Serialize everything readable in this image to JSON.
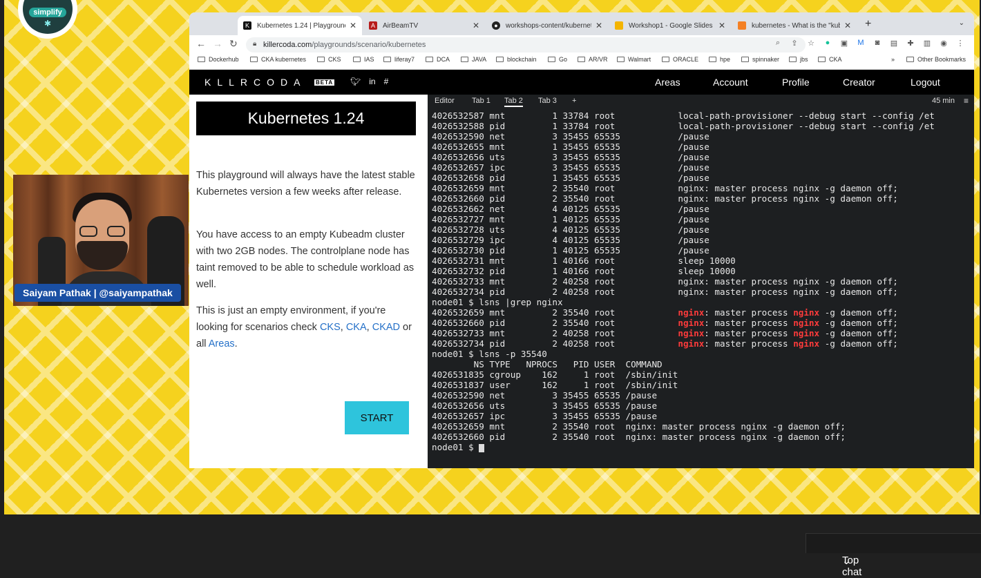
{
  "presenter": {
    "name": "Saiyam Pathak | @saiyampathak",
    "logo_text": "simplify"
  },
  "browser": {
    "tabs": [
      {
        "title": "Kubernetes 1.24 | Playgrounds",
        "favicon": "k-icon",
        "color": "#111111"
      },
      {
        "title": "AirBeamTV",
        "favicon": "airbeam-icon",
        "color": "#b71c1c"
      },
      {
        "title": "workshops-content/kubernete",
        "favicon": "github-icon",
        "color": "#222222"
      },
      {
        "title": "Workshop1 - Google Slides",
        "favicon": "slides-icon",
        "color": "#f4b400"
      },
      {
        "title": "kubernetes - What is the \"kube",
        "favicon": "stack-icon",
        "color": "#f48024"
      }
    ],
    "url_host": "killercoda.com",
    "url_path": "/playgrounds/scenario/kubernetes",
    "bookmarks": [
      "Dockerhub",
      "CKA kubernetes",
      "CKS",
      "IAS",
      "liferay7",
      "DCA",
      "JAVA",
      "blockchain",
      "Go",
      "AR/VR",
      "Walmart",
      "ORACLE",
      "hpe",
      "spinnaker",
      "jbs",
      "CKA"
    ],
    "more_bookmarks": "»",
    "other_bookmarks": "Other Bookmarks"
  },
  "site": {
    "brand": "KLLRCODA",
    "beta": "BETA",
    "nav": [
      "Areas",
      "Account",
      "Profile",
      "Creator",
      "Logout"
    ]
  },
  "scenario": {
    "title": "Kubernetes 1.24",
    "p1": "This playground will always have the latest stable Kubernetes version a few weeks after release.",
    "p2": "You have access to an empty Kubeadm cluster with two 2GB nodes. The controlplane node has taint removed to be able to schedule workload as well.",
    "p3_prefix": "This is just an empty environment, if you're looking for scenarios check",
    "links": [
      "CKS",
      "CKA",
      "CKAD"
    ],
    "or_all": "or all",
    "areas_link": "Areas",
    "start": "START"
  },
  "terminal": {
    "tabs": [
      "Editor",
      "Tab 1",
      "Tab 2",
      "Tab 3",
      "+"
    ],
    "active_tab": "Tab 2",
    "timer": "45 min",
    "lines": [
      "4026532587 mnt         1 33784 root            local-path-provisioner --debug start --config /et",
      "4026532588 pid         1 33784 root            local-path-provisioner --debug start --config /et",
      "4026532590 net         3 35455 65535           /pause",
      "4026532655 mnt         1 35455 65535           /pause",
      "4026532656 uts         3 35455 65535           /pause",
      "4026532657 ipc         3 35455 65535           /pause",
      "4026532658 pid         1 35455 65535           /pause",
      "4026532659 mnt         2 35540 root            nginx: master process nginx -g daemon off;",
      "4026532660 pid         2 35540 root            nginx: master process nginx -g daemon off;",
      "4026532662 net         4 40125 65535           /pause",
      "4026532727 mnt         1 40125 65535           /pause",
      "4026532728 uts         4 40125 65535           /pause",
      "4026532729 ipc         4 40125 65535           /pause",
      "4026532730 pid         1 40125 65535           /pause",
      "4026532731 mnt         1 40166 root            sleep 10000",
      "4026532732 pid         1 40166 root            sleep 10000",
      "4026532733 mnt         2 40258 root            nginx: master process nginx -g daemon off;",
      "4026532734 pid         2 40258 root            nginx: master process nginx -g daemon off;",
      "node01 $ lsns |grep nginx",
      "4026532659 mnt         2 35540 root            nginx: master process nginx -g daemon off;",
      "4026532660 pid         2 35540 root            nginx: master process nginx -g daemon off;",
      "4026532733 mnt         2 40258 root            nginx: master process nginx -g daemon off;",
      "4026532734 pid         2 40258 root            nginx: master process nginx -g daemon off;",
      "node01 $ lsns -p 35540",
      "        NS TYPE   NPROCS   PID USER  COMMAND",
      "4026531835 cgroup    162     1 root  /sbin/init",
      "4026531837 user      162     1 root  /sbin/init",
      "4026532590 net         3 35455 65535 /pause",
      "4026532656 uts         3 35455 65535 /pause",
      "4026532657 ipc         3 35455 65535 /pause",
      "4026532659 mnt         2 35540 root  nginx: master process nginx -g daemon off;",
      "4026532660 pid         2 35540 root  nginx: master process nginx -g daemon off;",
      "node01 $ "
    ],
    "highlight_word": "nginx",
    "highlight_lines": [
      19,
      20,
      21,
      22
    ]
  },
  "chat": {
    "label": "Top chat"
  },
  "colors": {
    "accent": "#2ec4dc",
    "highlight": "#ff3b3b",
    "name_bar": "#1a4fa3",
    "stage": "#f5d21e"
  }
}
